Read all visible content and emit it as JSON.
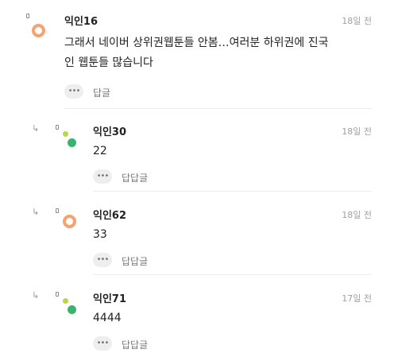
{
  "icons": {
    "more": "ellipsis-icon",
    "reply_arrow": "reply-arrow-icon"
  },
  "comments": [
    {
      "nickname": "익인16",
      "time": "18일 전",
      "text_line1": "그래서 네이버 상위권웹툰들 안봄…여러분 하위권에 진국",
      "text_line2": "인 웹툰들 많습니다",
      "more_label": "•••",
      "reply_label": "답글"
    },
    {
      "nickname": "익인30",
      "time": "18일 전",
      "text": "22",
      "more_label": "•••",
      "reply_label": "답답글"
    },
    {
      "nickname": "익인62",
      "time": "18일 전",
      "text": "33",
      "more_label": "•••",
      "reply_label": "답답글"
    },
    {
      "nickname": "익인71",
      "time": "17일 전",
      "text": "4444",
      "more_label": "•••",
      "reply_label": "답답글"
    }
  ],
  "colors": {
    "avatar_orange": "#f4a371",
    "avatar_green_light": "#b5d84a",
    "avatar_green": "#3bb36e",
    "divider": "#ececec",
    "muted_text": "#a0a0a0"
  }
}
